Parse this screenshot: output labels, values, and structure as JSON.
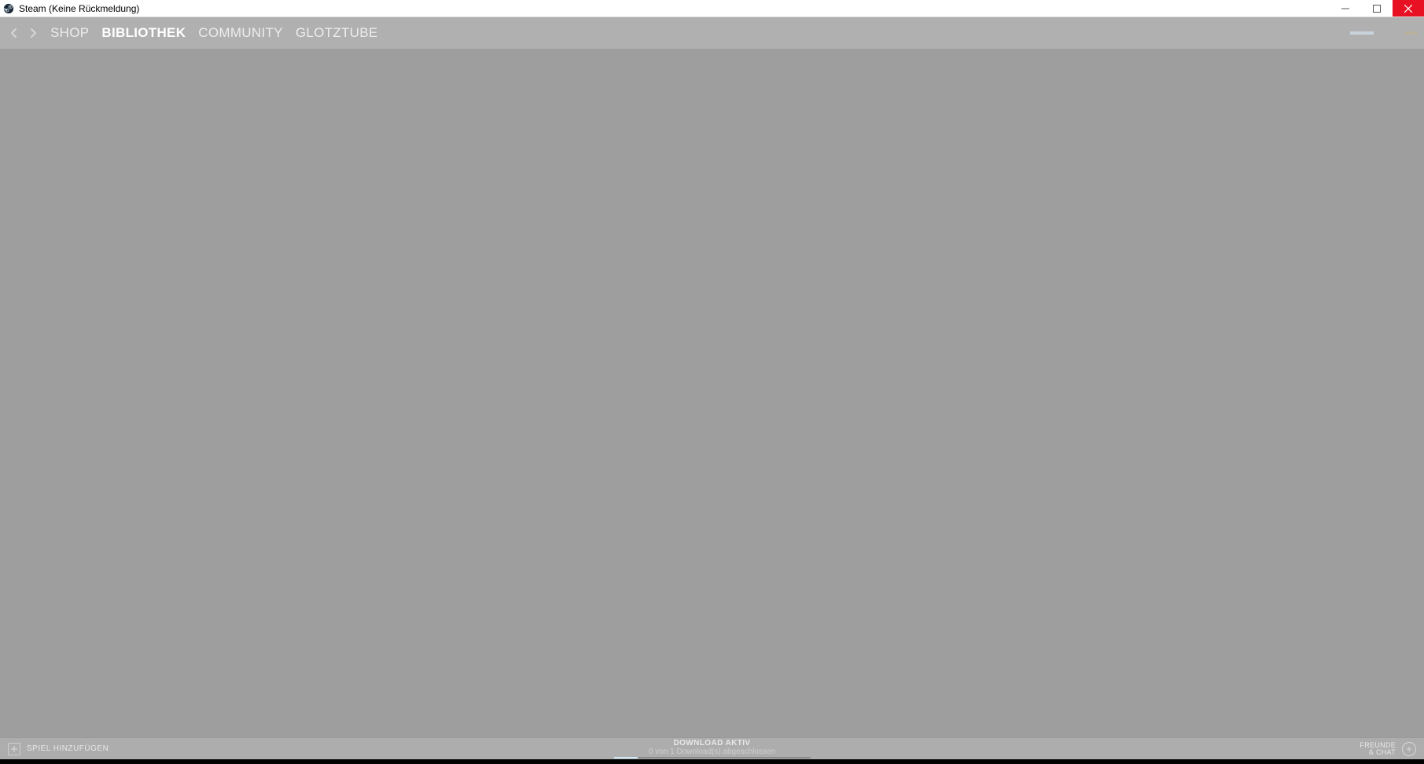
{
  "window": {
    "title": "Steam (Keine Rückmeldung)"
  },
  "nav": {
    "items": [
      {
        "label": "SHOP",
        "active": false
      },
      {
        "label": "BIBLIOTHEK",
        "active": true
      },
      {
        "label": "COMMUNITY",
        "active": false
      },
      {
        "label": "GLOTZTUBE",
        "active": false
      }
    ]
  },
  "bottom": {
    "add_game": "SPIEL HINZUFÜGEN",
    "download_title": "DOWNLOAD AKTIV",
    "download_sub": "0 von 1 Download(s) abgeschlossen",
    "friends_line1": "FREUNDE",
    "friends_line2": "& CHAT"
  }
}
